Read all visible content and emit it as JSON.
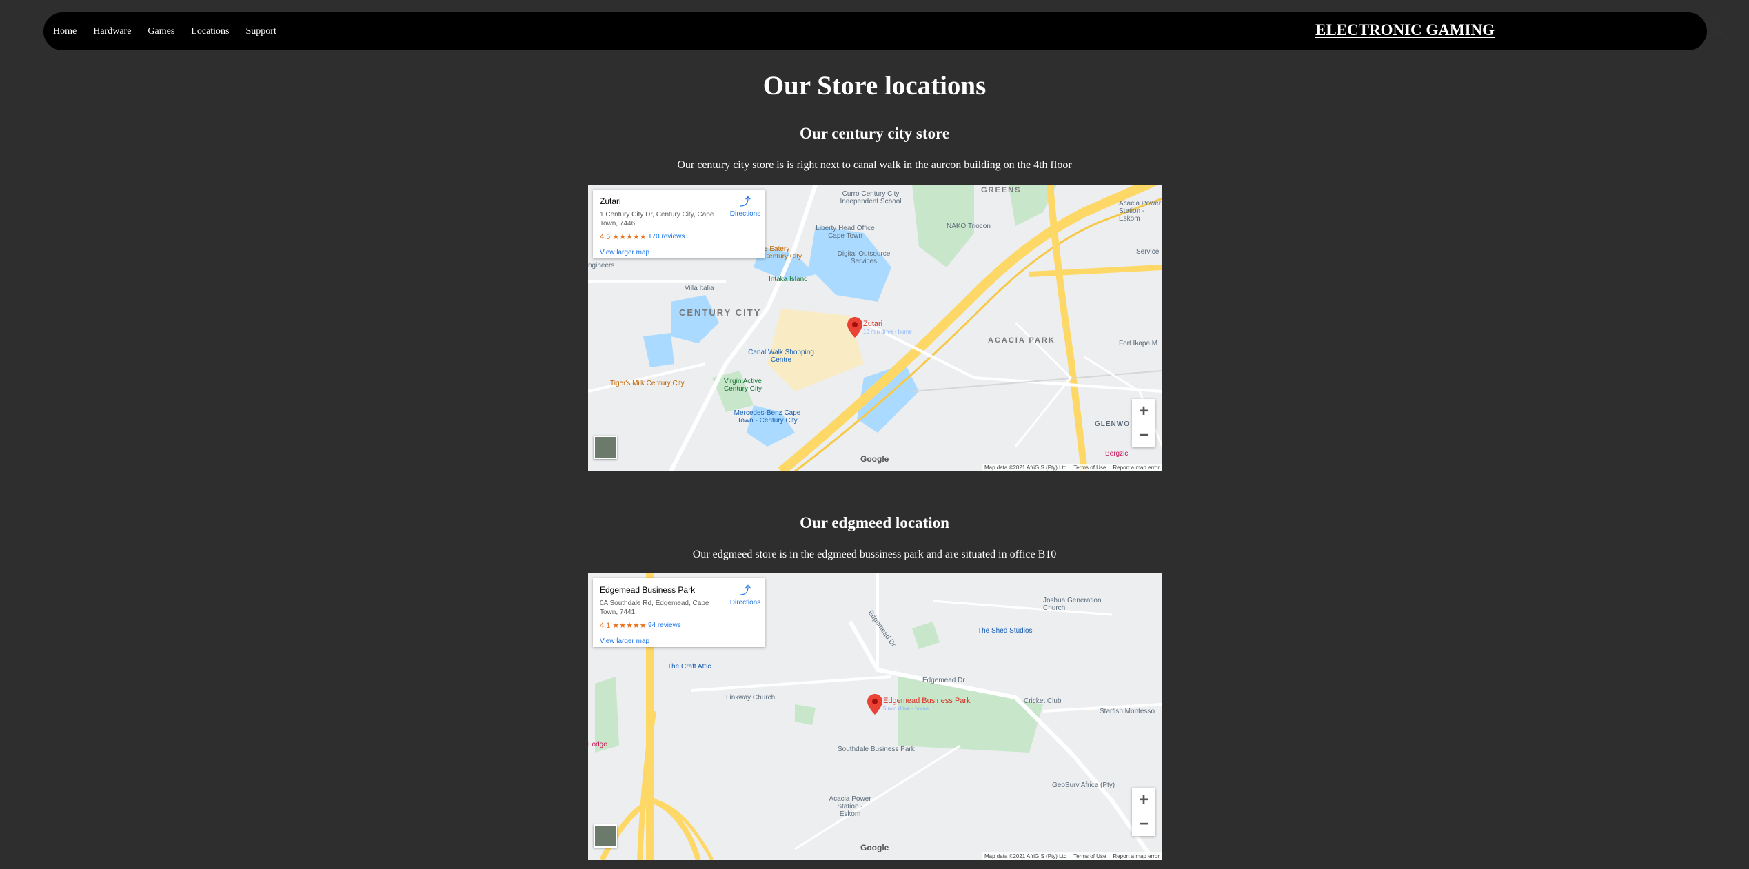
{
  "nav": {
    "links": [
      "Home",
      "Hardware",
      "Games",
      "Locations",
      "Support"
    ],
    "brand": "ELECTRONIC GAMING"
  },
  "page": {
    "title": "Our Store locations"
  },
  "sections": [
    {
      "title": "Our century city store",
      "description": "Our century city store is is right next to canal walk in the aurcon building on the 4th floor",
      "map": {
        "place": "Zutari",
        "address": "1 Century City Dr, Century City, Cape Town, 7446",
        "rating": "4.5 ★★★★★",
        "reviews": "170 reviews",
        "directions": "Directions",
        "larger": "View larger map",
        "pin_label": "Zutari",
        "pin_sub": "10 min drive - home",
        "labels": {
          "area1": "CENTURY CITY",
          "area2": "ACACIA PARK",
          "area3": "GREENS",
          "canal": "Canal Walk Shopping Centre",
          "liberty": "Liberty Head Office Cape Town",
          "digital": "Digital Outsource Services",
          "curro": "Curro Century City Independent School",
          "nako": "NAKO Triocon",
          "intaka": "Intaka Island",
          "villa": "Villa Italia",
          "tigers": "Tiger's Milk Century City",
          "virgin": "Virgin Active Century City",
          "merc": "Mercedes-Benz Cape Town - Century City",
          "fort": "Fort Ikapa M",
          "acacia": "Acacia Power Station - Eskom",
          "eatery": "e Eatery Century City",
          "glen": "GLENWO",
          "berg": "Bergzic",
          "service": "Service",
          "eng": "ngineers"
        },
        "google": "Google",
        "attribution": [
          "Map data ©2021 AfriGIS (Pty) Ltd",
          "Terms of Use",
          "Report a map error"
        ]
      }
    },
    {
      "title": "Our edgmeed location",
      "description": "Our edgmeed store is in the edgmeed bussiness park and are situated in office B10",
      "map": {
        "place": "Edgemead Business Park",
        "address": "0A Southdale Rd, Edgemead, Cape Town, 7441",
        "rating": "4.1 ★★★★★",
        "reviews": "94 reviews",
        "directions": "Directions",
        "larger": "View larger map",
        "pin_label": "Edgemead Business Park",
        "pin_sub": "5 min drive - home",
        "labels": {
          "joshua": "Joshua Generation Church",
          "shed": "The Shed Studios",
          "craft": "The Craft Attic",
          "linkway": "Linkway Church",
          "southdale": "Southdale Business Park",
          "cricket": "Cricket Club",
          "starfish": "Starfish Montesso",
          "geosurv": "GeoSurv Africa (Pty)",
          "acacia2": "Acacia Power Station - Eskom",
          "lodge": "Lodge",
          "edgemead_dr": "Edgemead Dr",
          "edgemead_dr2": "Edgemead Dr"
        },
        "google": "Google",
        "attribution": [
          "Map data ©2021 AfriGIS (Pty) Ltd",
          "Terms of Use",
          "Report a map error"
        ]
      }
    }
  ],
  "colors": {
    "background": "#2e2e2e",
    "navbar": "#000000",
    "road": "#fdd866",
    "water": "#aadaff",
    "park": "#c8e6c9",
    "pin": "#ea4335"
  }
}
